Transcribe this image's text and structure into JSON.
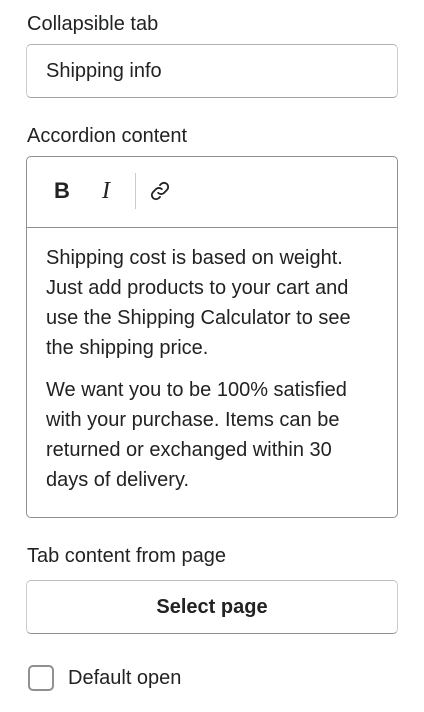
{
  "collapsible_tab": {
    "label": "Collapsible tab",
    "value": "Shipping info"
  },
  "accordion_content": {
    "label": "Accordion content",
    "toolbar": {
      "bold_glyph": "B",
      "italic_glyph": "I",
      "link_icon": "link-icon"
    },
    "paragraphs": [
      "Shipping cost is based on weight. Just add products to your cart and use the Shipping Calculator to see the shipping price.",
      "We want you to be 100% satisfied with your purchase. Items can be returned or exchanged within 30 days of delivery."
    ]
  },
  "tab_content_from_page": {
    "label": "Tab content from page",
    "button_label": "Select page"
  },
  "default_open": {
    "label": "Default open",
    "checked": false
  }
}
